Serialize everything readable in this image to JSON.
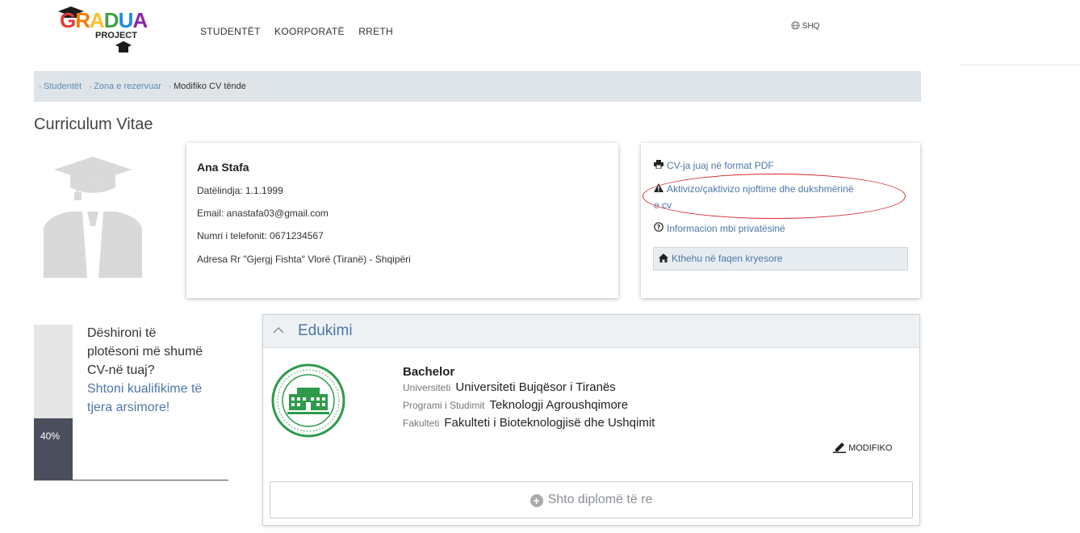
{
  "header": {
    "logo_text": "GRADUA",
    "logo_sub": "PROJECT",
    "nav": [
      "STUDENTËT",
      "KOORPORATË",
      "RRETH"
    ],
    "lang": "SHQ"
  },
  "breadcrumb": [
    "Studentët",
    "Zona e rezervuar",
    "Modifiko CV tënde"
  ],
  "page_title": "Curriculum Vitae",
  "profile": {
    "name": "Ana Stafa",
    "birthdate": "Datëlindja: 1.1.1999",
    "email": "Email: anastafa03@gmail.com",
    "phone": "Numri i telefonit: 0671234567",
    "address": "Adresa Rr \"Gjergj Fishta\" Vlorë (Tiranë) - Shqipëri"
  },
  "actions": {
    "pdf": "CV-ja juaj në format PDF",
    "notifications_1": "Aktivizo/çaktivizo njoftime dhe dukshmërinë",
    "notifications_2": "e cv",
    "privacy": "Informacion mbi privatësinë",
    "home": "Kthehu në faqen kryesore"
  },
  "progress": {
    "label": "40%",
    "value": 40,
    "text_1": "Dëshironi të",
    "text_2": "plotësoni më shumë",
    "text_3": "CV-në tuaj?",
    "link_1": "Shtoni kualifikime të",
    "link_2": "tjera arsimore!"
  },
  "education": {
    "title": "Edukimi",
    "degree": "Bachelor",
    "university_key": "Universiteti",
    "university": "Universiteti Bujqësor i Tiranës",
    "program_key": "Programi i Studimit",
    "program": "Teknologji Agroushqimore",
    "faculty_key": "Fakulteti",
    "faculty": "Fakulteti i Bioteknologjisë dhe Ushqimit",
    "edit": "MODIFIKO",
    "add": "Shto diplomë të re"
  },
  "colors": {
    "link": "#4d77a8",
    "breadcrumb_bg": "#dfe4e9",
    "progress_fill": "#4b4f5d",
    "highlight_ellipse": "#d7262a",
    "seal_green": "#2e9a4a"
  },
  "icons": [
    "graduation-cap-logo",
    "globe-icon",
    "printer-icon",
    "warning-icon",
    "question-icon",
    "home-icon",
    "chevron-up-icon",
    "pencil-icon",
    "plus-circle-icon"
  ]
}
